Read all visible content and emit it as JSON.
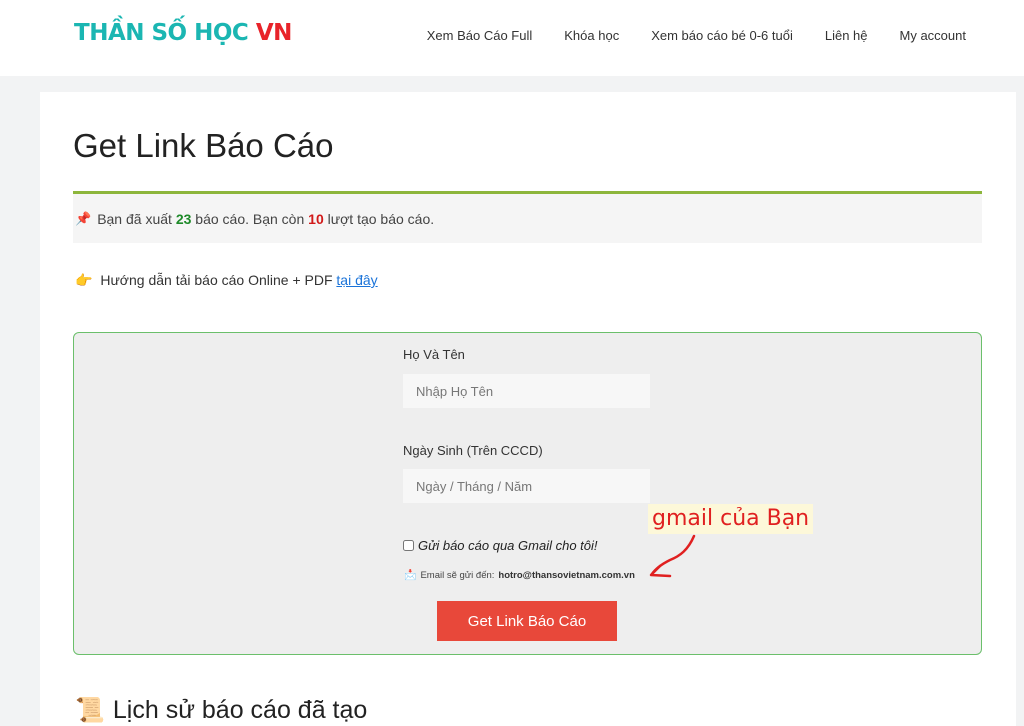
{
  "header": {
    "logo_part1": "THẦN SỐ HỌC",
    "logo_part2": "VN",
    "nav": [
      "Xem Báo Cáo Full",
      "Khóa học",
      "Xem báo cáo bé 0-6 tuổi",
      "Liên hệ",
      "My account"
    ]
  },
  "page": {
    "title": "Get Link Báo Cáo"
  },
  "stats": {
    "icon": "pushpin-icon",
    "prefix": "Bạn đã xuất",
    "exported": "23",
    "middle": "báo cáo. Bạn còn",
    "remaining": "10",
    "suffix": "lượt tạo báo cáo."
  },
  "guide": {
    "icon": "pointing-hand-icon",
    "text": "Hướng dẫn tải báo cáo Online + PDF",
    "link": "tại đây"
  },
  "form": {
    "name_label": "Họ Và Tên",
    "name_placeholder": "Nhập Họ Tên",
    "dob_label": "Ngày Sinh (Trên CCCD)",
    "dob_placeholder": "Ngày / Tháng / Năm",
    "checkbox_label": "Gửi báo cáo qua Gmail cho tôi!",
    "checkbox_checked": false,
    "email_prefix": "Email sẽ gửi đến:",
    "email": "hotro@thansovietnam.com.vn",
    "submit_label": "Get Link Báo Cáo"
  },
  "annotation": {
    "text": "gmail của Bạn",
    "color": "#e02020"
  },
  "history": {
    "icon": "scroll-icon",
    "title": "Lịch sử báo cáo đã tạo"
  },
  "colors": {
    "accent_green": "#8db63c",
    "button_red": "#e8483a",
    "logo_teal": "#1bb6b2",
    "logo_red": "#e8232a"
  }
}
